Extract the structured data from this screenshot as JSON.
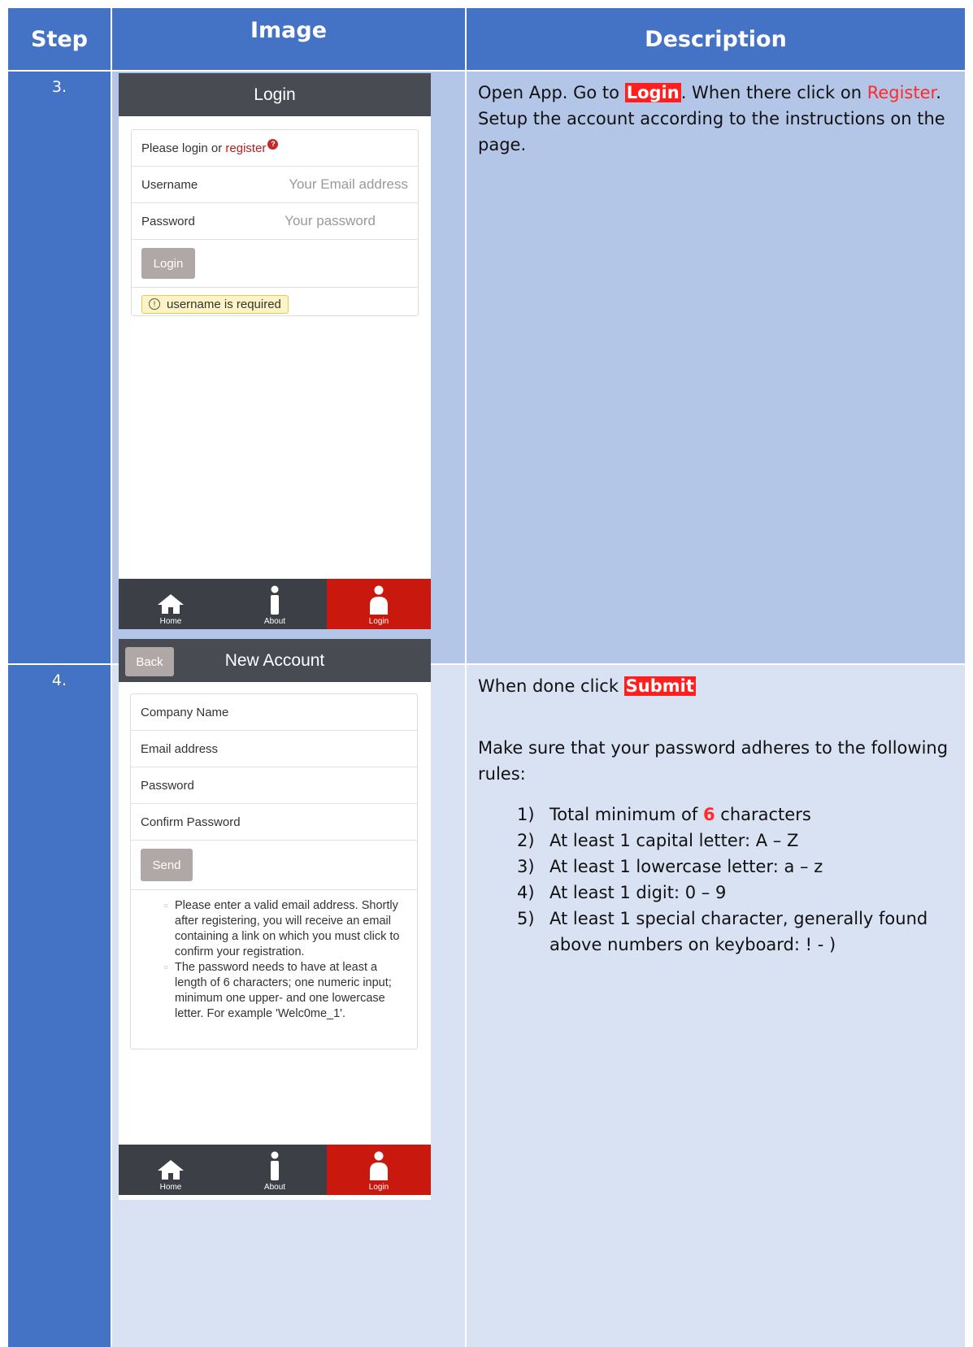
{
  "header": {
    "step": "Step",
    "image": "Image",
    "description": "Description"
  },
  "row3": {
    "step": "3.",
    "screen": {
      "title": "Login",
      "prompt_prefix": "Please login or ",
      "prompt_link": "register",
      "username_label": "Username",
      "username_placeholder": "Your Email address",
      "password_label": "Password",
      "password_placeholder": "Your password",
      "login_button": "Login",
      "warning": "username is required"
    },
    "desc": {
      "p1": "Open App. Go to ",
      "login": "Login",
      "p2": ". When there click on ",
      "register": "Register",
      "p3": ". Setup the account according to the instructions on the page."
    }
  },
  "row4": {
    "step": "4.",
    "screen": {
      "back": "Back",
      "title": "New Account",
      "company": "Company Name",
      "email": "Email address",
      "password": "Password",
      "confirm": "Confirm Password",
      "send": "Send",
      "note1": "Please enter a valid email address. Shortly after registering, you will receive an email containing a link on which you must click to confirm your registration.",
      "note2": "The password needs to have at least a length of 6 characters; one numeric input; minimum one upper- and one lowercase letter. For example 'Welc0me_1'."
    },
    "desc": {
      "line1": "When done click ",
      "submit": "Submit",
      "line2": "Make sure that your password adheres to the following rules:",
      "rules": [
        {
          "n": "1)",
          "pre": "Total minimum of ",
          "hl": "6",
          "post": " characters"
        },
        {
          "n": "2)",
          "text": "At least 1 capital letter: A – Z"
        },
        {
          "n": "3)",
          "text": "At least 1 lowercase letter: a – z"
        },
        {
          "n": "4)",
          "text": "At least 1 digit: 0 – 9"
        },
        {
          "n": "5)",
          "text": "At least 1 special character, generally found above numbers on keyboard: ! - )"
        }
      ]
    }
  },
  "tabbar": {
    "home": "Home",
    "about": "About",
    "login": "Login"
  },
  "colors": {
    "header_blue": "#4472c4",
    "row3_bg": "#b4c6e7",
    "row4_bg": "#d9e2f3",
    "active_tab": "#c9190e",
    "highlight": "#ff1f1f"
  },
  "icons": [
    "help-icon",
    "warning-icon",
    "home-icon",
    "info-icon",
    "user-icon"
  ]
}
